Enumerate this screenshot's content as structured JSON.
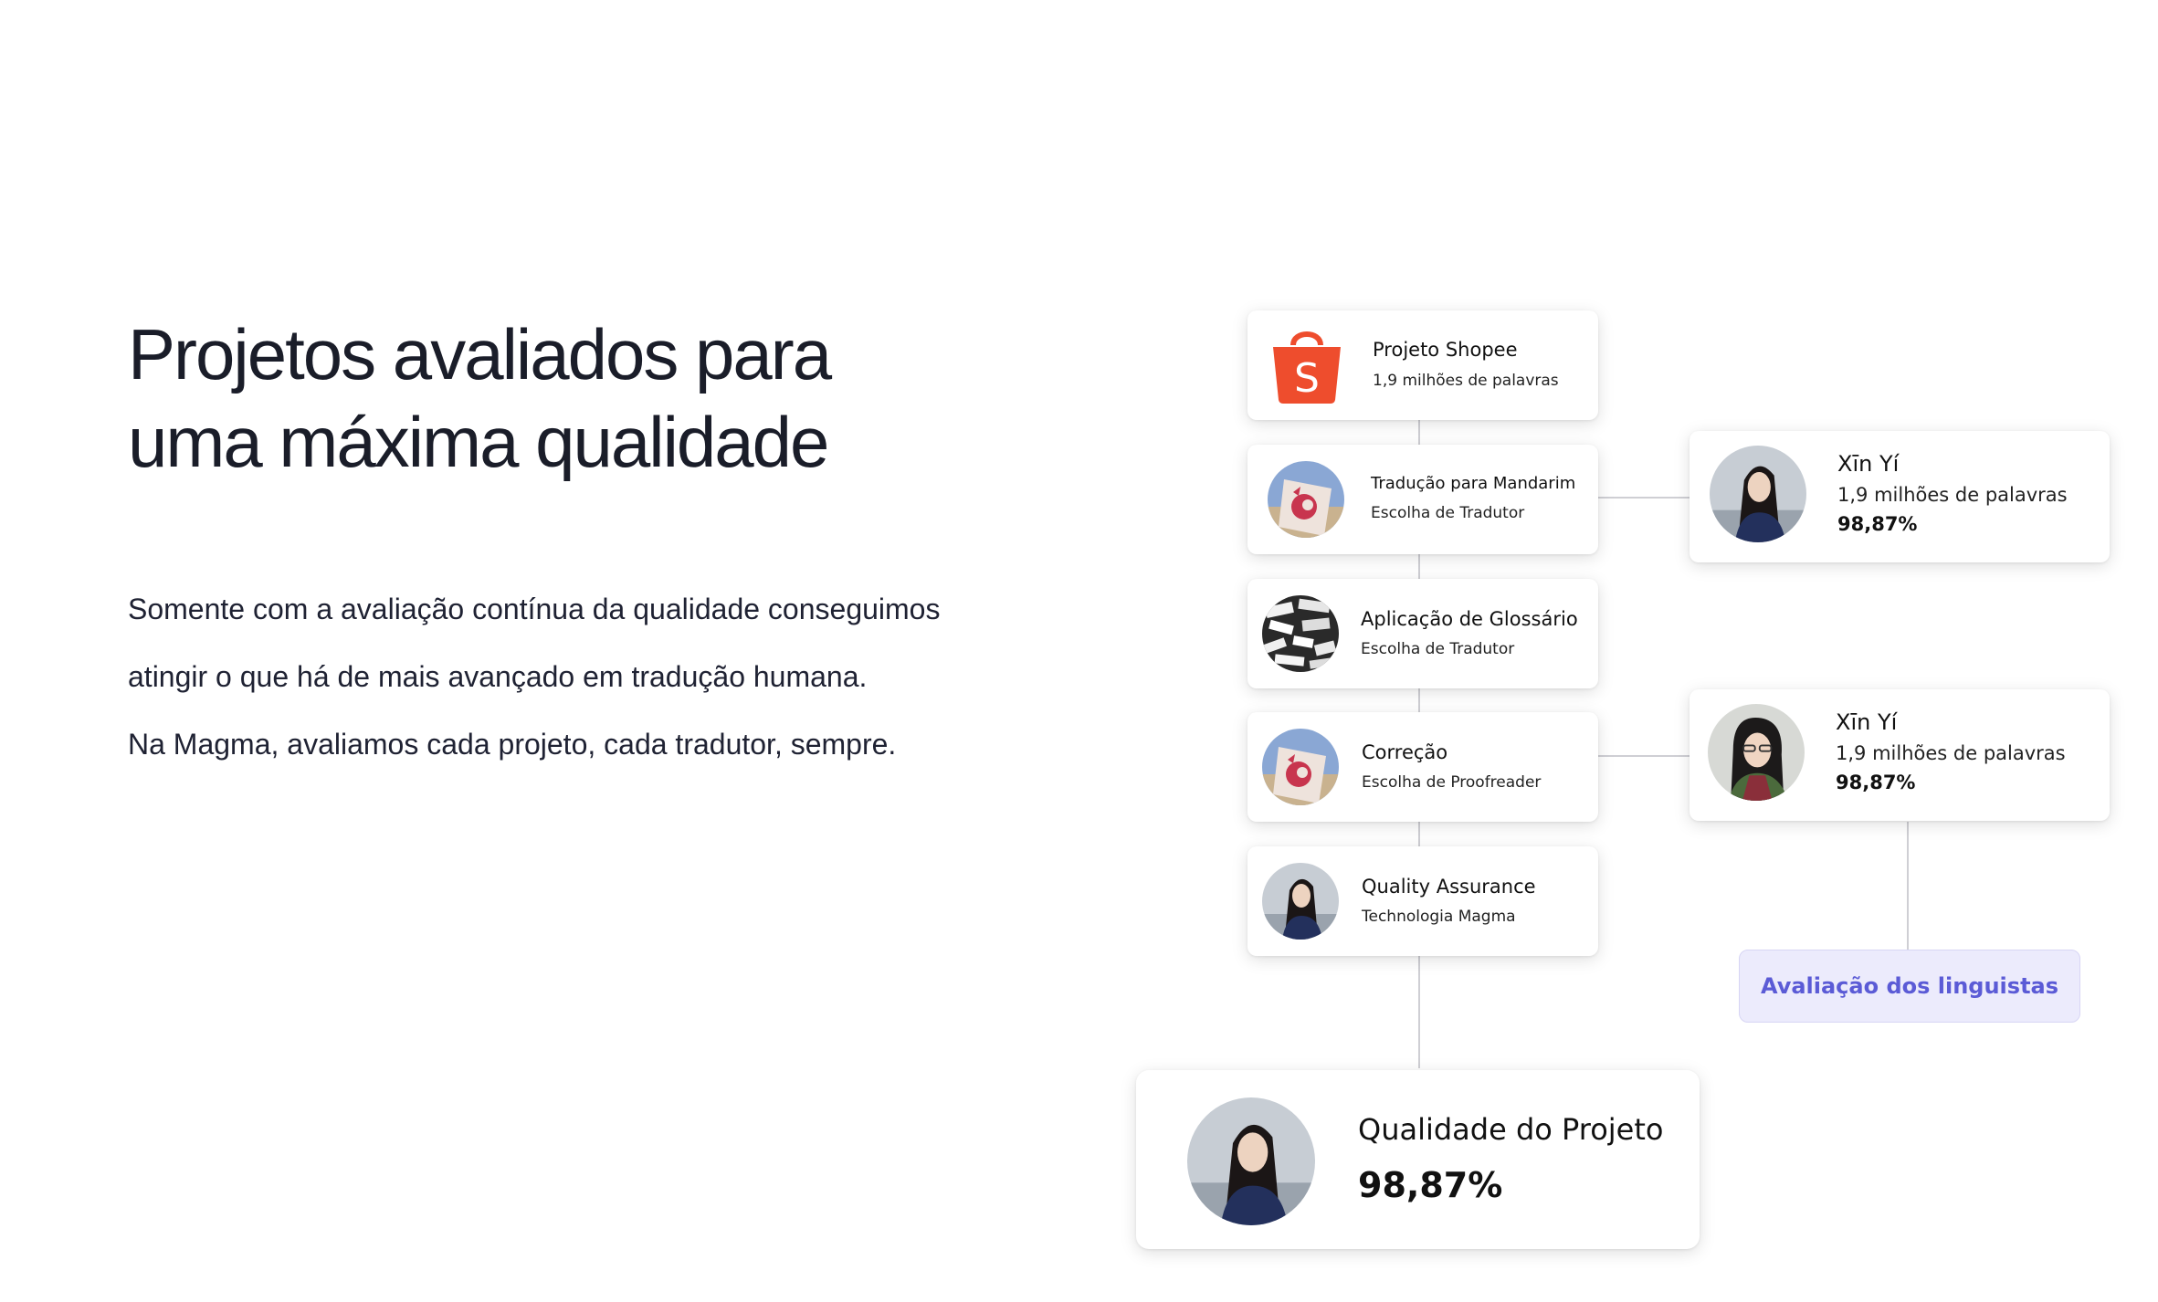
{
  "heading": {
    "line1": "Projetos avaliados para",
    "line2": "uma máxima qualidade"
  },
  "body": {
    "p1": "Somente com a avaliação contínua da qualidade conseguimos",
    "p2": "atingir o que há de mais avançado em tradução humana.",
    "p3": "Na Magma, avaliamos cada projeto, cada tradutor, sempre."
  },
  "steps": [
    {
      "title": "Projeto Shopee",
      "subtitle": "1,9 milhões de palavras",
      "icon": "shopee-bag-icon"
    },
    {
      "title": "Tradução para Mandarim",
      "subtitle": "Escolha de Tradutor",
      "icon": "mandarin-flag-avatar"
    },
    {
      "title": "Aplicação de  Glossário",
      "subtitle": "Escolha de Tradutor",
      "icon": "word-collage-avatar"
    },
    {
      "title": "Correção",
      "subtitle": "Escolha de Proofreader",
      "icon": "mandarin-flag-avatar"
    },
    {
      "title": "Quality Assurance",
      "subtitle": "Technologia Magma",
      "icon": "person-avatar"
    }
  ],
  "linguists": [
    {
      "name": "Xīn Yí",
      "words": "1,9 milhões de palavras",
      "score": "98,87%"
    },
    {
      "name": "Xīn Yí",
      "words": "1,9 milhões de palavras",
      "score": "98,87%"
    }
  ],
  "linguist_badge": "Avaliação dos linguistas",
  "result": {
    "title": "Qualidade do Projeto",
    "score": "98,87%"
  },
  "colors": {
    "shopee": "#ee4d2d",
    "badge_text": "#5b5bd6",
    "badge_bg": "#ecebfc",
    "heading": "#1a1d29"
  }
}
